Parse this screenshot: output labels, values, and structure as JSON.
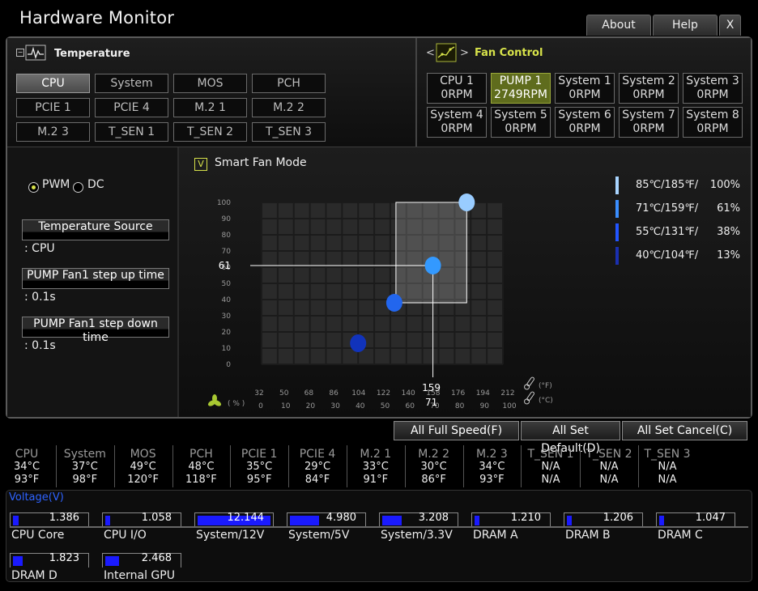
{
  "window": {
    "title": "Hardware Monitor",
    "about": "About",
    "help": "Help",
    "close": "X"
  },
  "temperature": {
    "heading": "Temperature",
    "sources": [
      "CPU",
      "System",
      "MOS",
      "PCH",
      "PCIE 1",
      "PCIE 4",
      "M.2 1",
      "M.2 2",
      "M.2 3",
      "T_SEN 1",
      "T_SEN 2",
      "T_SEN 3"
    ],
    "selected": 0
  },
  "fan_control": {
    "heading": "Fan Control",
    "prev": "<",
    "next": ">",
    "fans": [
      {
        "name": "CPU 1",
        "rpm": "0RPM"
      },
      {
        "name": "PUMP 1",
        "rpm": "2749RPM"
      },
      {
        "name": "System 1",
        "rpm": "0RPM"
      },
      {
        "name": "System 2",
        "rpm": "0RPM"
      },
      {
        "name": "System 3",
        "rpm": "0RPM"
      },
      {
        "name": "System 4",
        "rpm": "0RPM"
      },
      {
        "name": "System 5",
        "rpm": "0RPM"
      },
      {
        "name": "System 6",
        "rpm": "0RPM"
      },
      {
        "name": "System 7",
        "rpm": "0RPM"
      },
      {
        "name": "System 8",
        "rpm": "0RPM"
      }
    ],
    "selected": 1
  },
  "left_panel": {
    "pwm": "PWM",
    "dc": "DC",
    "temp_source_btn": "Temperature Source",
    "temp_source_val": ": CPU",
    "step_up_btn": "PUMP Fan1 step up time",
    "step_up_val": ": 0.1s",
    "step_down_btn": "PUMP Fan1 step down time",
    "step_down_val": ": 0.1s"
  },
  "smart_fan": {
    "check": "V",
    "label": "Smart Fan Mode"
  },
  "chart_data": {
    "type": "scatter",
    "y_ticks": [
      "100",
      "90",
      "80",
      "70",
      "60",
      "50",
      "40",
      "30",
      "20",
      "10",
      "0"
    ],
    "x_ticks_f": [
      "32",
      "50",
      "68",
      "86",
      "104",
      "122",
      "140",
      "158",
      "176",
      "194",
      "212"
    ],
    "x_ticks_c": [
      "0",
      "10",
      "20",
      "30",
      "40",
      "50",
      "60",
      "70",
      "80",
      "90",
      "100"
    ],
    "ylim": [
      0,
      100
    ],
    "xlim": [
      0,
      100
    ],
    "y_unit": "( % )",
    "x_unit_f": "(°F)",
    "x_unit_c": "(°C)",
    "points": [
      {
        "x": 40,
        "y": 13,
        "color": "#1133bb"
      },
      {
        "x": 55,
        "y": 38,
        "color": "#2266ee"
      },
      {
        "x": 71,
        "y": 61,
        "color": "#3399ff"
      },
      {
        "x": 85,
        "y": 100,
        "color": "#99ccff"
      }
    ],
    "current": {
      "x_c": "71",
      "x_f": "159",
      "y": "61"
    },
    "legend": [
      {
        "temp": "85℃/185℉/",
        "pct": "100%",
        "color": "#a8d4ff"
      },
      {
        "temp": "71℃/159℉/",
        "pct": "61%",
        "color": "#3a8eff"
      },
      {
        "temp": "55℃/131℉/",
        "pct": "38%",
        "color": "#2255ff"
      },
      {
        "temp": "40℃/104℉/",
        "pct": "13%",
        "color": "#1a2fb0"
      }
    ]
  },
  "actions": {
    "full_speed": "All Full Speed(F)",
    "set_default": "All Set Default(D)",
    "set_cancel": "All Set Cancel(C)"
  },
  "temps": [
    {
      "name": "CPU",
      "c": "34°C",
      "f": "93°F"
    },
    {
      "name": "System",
      "c": "37°C",
      "f": "98°F"
    },
    {
      "name": "MOS",
      "c": "49°C",
      "f": "120°F"
    },
    {
      "name": "PCH",
      "c": "48°C",
      "f": "118°F"
    },
    {
      "name": "PCIE 1",
      "c": "35°C",
      "f": "95°F"
    },
    {
      "name": "PCIE 4",
      "c": "29°C",
      "f": "84°F"
    },
    {
      "name": "M.2 1",
      "c": "33°C",
      "f": "91°F"
    },
    {
      "name": "M.2 2",
      "c": "30°C",
      "f": "86°F"
    },
    {
      "name": "M.2 3",
      "c": "34°C",
      "f": "93°F"
    },
    {
      "name": "T_SEN 1",
      "c": "N/A",
      "f": "N/A"
    },
    {
      "name": "T_SEN 2",
      "c": "N/A",
      "f": "N/A"
    },
    {
      "name": "T_SEN 3",
      "c": "N/A",
      "f": "N/A"
    }
  ],
  "voltage": {
    "heading": "Voltage(V)",
    "items": [
      {
        "name": "CPU Core",
        "value": "1.386",
        "level": 0.08
      },
      {
        "name": "CPU I/O",
        "value": "1.058",
        "level": 0.06
      },
      {
        "name": "System/12V",
        "value": "12.144",
        "level": 1.0
      },
      {
        "name": "System/5V",
        "value": "4.980",
        "level": 0.4
      },
      {
        "name": "System/3.3V",
        "value": "3.208",
        "level": 0.27
      },
      {
        "name": "DRAM A",
        "value": "1.210",
        "level": 0.07
      },
      {
        "name": "DRAM B",
        "value": "1.206",
        "level": 0.07
      },
      {
        "name": "DRAM C",
        "value": "1.047",
        "level": 0.06
      },
      {
        "name": "DRAM D",
        "value": "1.823",
        "level": 0.13
      },
      {
        "name": "Internal GPU",
        "value": "2.468",
        "level": 0.19
      }
    ]
  }
}
